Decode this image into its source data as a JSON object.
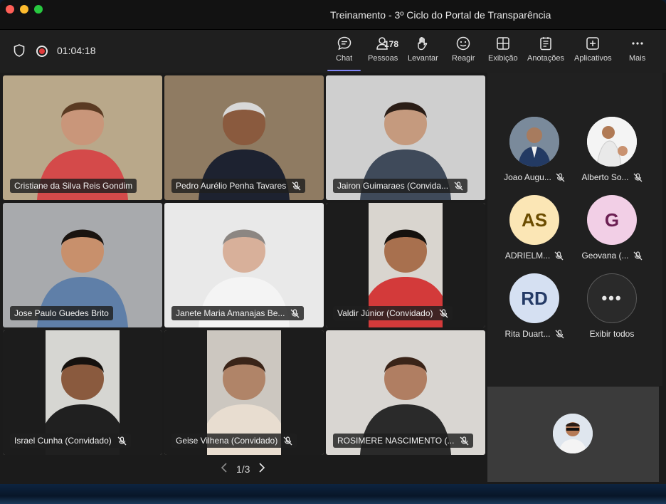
{
  "window": {
    "title": "Treinamento - 3º Ciclo do Portal de Transparência"
  },
  "toolbar": {
    "timer": "01:04:18",
    "people_count": "178",
    "buttons": [
      {
        "label": "Chat",
        "icon": "chat-icon"
      },
      {
        "label": "Pessoas",
        "icon": "people-icon"
      },
      {
        "label": "Levantar",
        "icon": "raise-hand-icon"
      },
      {
        "label": "Reagir",
        "icon": "react-icon"
      },
      {
        "label": "Exibição",
        "icon": "view-icon"
      },
      {
        "label": "Anotações",
        "icon": "notes-icon"
      },
      {
        "label": "Aplicativos",
        "icon": "apps-icon"
      },
      {
        "label": "Mais",
        "icon": "more-icon"
      }
    ]
  },
  "grid": {
    "tiles": [
      {
        "name": "Cristiane da Silva Reis Gondim",
        "muted": false,
        "bg": "#b9a88a"
      },
      {
        "name": "Pedro Aurélio Penha Tavares",
        "muted": true,
        "bg": "#8f7b62"
      },
      {
        "name": "Jairon Guimaraes (Convida...",
        "muted": true,
        "bg": "#cfcfcf"
      },
      {
        "name": "Jose Paulo Guedes Brito",
        "muted": false,
        "bg": "#a8aaad"
      },
      {
        "name": "Janete Maria Amanajas Be...",
        "muted": true,
        "bg": "#e9e9e9"
      },
      {
        "name": "Valdir Júnior (Convidado)",
        "muted": true,
        "bg": "#d9d5cf"
      },
      {
        "name": "Israel Cunha (Convidado)",
        "muted": true,
        "bg": "#d6d6d2"
      },
      {
        "name": "Geise Vilhena (Convidado)",
        "muted": true,
        "bg": "#ccc7c0"
      },
      {
        "name": "ROSIMERE NASCIMENTO (...",
        "muted": true,
        "bg": "#d9d6d2"
      }
    ],
    "pager": "1/3"
  },
  "side": {
    "participants": [
      {
        "name": "Joao Augu...",
        "initials": "",
        "color": "#6d7f94"
      },
      {
        "name": "Alberto So...",
        "initials": "",
        "color": "#f2f2f2"
      },
      {
        "name": "ADRIELM...",
        "initials": "AS",
        "color": "#fbe6b5",
        "text": "#6b4c00"
      },
      {
        "name": "Geovana (...",
        "initials": "G",
        "color": "#f2cfe6",
        "text": "#6b1f52"
      },
      {
        "name": "Rita Duart...",
        "initials": "RD",
        "color": "#d5e0f2",
        "text": "#243a66"
      }
    ],
    "show_all_label": "Exibir todos"
  }
}
